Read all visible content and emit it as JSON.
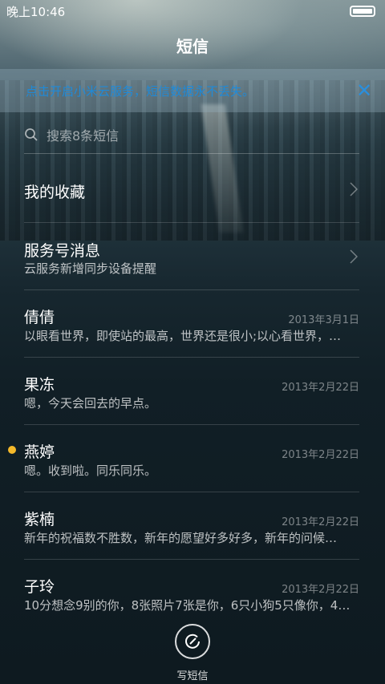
{
  "status_bar": {
    "time": "晚上10:46"
  },
  "header": {
    "title": "短信"
  },
  "banner": {
    "text": "点击开启小米云服务，短信数据永不丢失。",
    "close_label": "✕"
  },
  "search": {
    "placeholder": "搜索8条短信"
  },
  "favorites": {
    "label": "我的收藏"
  },
  "service": {
    "label": "服务号消息",
    "subtitle": "云服务新增同步设备提醒"
  },
  "conversations": [
    {
      "name": "倩倩",
      "date": "2013年3月1日",
      "preview": "以眼看世界，即使站的最高，世界还是很小;以心看世界，…",
      "unread": false
    },
    {
      "name": "果冻",
      "date": "2013年2月22日",
      "preview": "嗯，今天会回去的早点。",
      "unread": false
    },
    {
      "name": "燕婷",
      "date": "2013年2月22日",
      "preview": "嗯。收到啦。同乐同乐。",
      "unread": true
    },
    {
      "name": "紫楠",
      "date": "2013年2月22日",
      "preview": "新年的祝福数不胜数，新年的愿望好多好多，新年的问候…",
      "unread": false
    },
    {
      "name": "子玲",
      "date": "2013年2月22日",
      "preview": "10分想念9别的你，8张照片7张是你，6只小狗5只像你，4…",
      "unread": false
    }
  ],
  "compose": {
    "label": "写短信"
  },
  "colors": {
    "banner_text": "#1f8ad8",
    "unread_dot": "#f4b92a"
  }
}
